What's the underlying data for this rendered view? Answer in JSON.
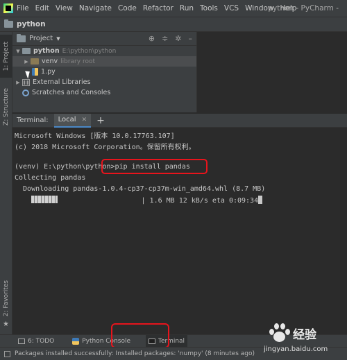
{
  "menubar": {
    "items": [
      "File",
      "Edit",
      "View",
      "Navigate",
      "Code",
      "Refactor",
      "Run",
      "Tools",
      "VCS",
      "Window",
      "Help"
    ],
    "window_title": "python - PyCharm -"
  },
  "breadcrumb": {
    "label": "python"
  },
  "left_stripe": {
    "project_tab": "1: Project",
    "structure_tab": "Z: Structure",
    "favorites_tab": "2: Favorites"
  },
  "project_panel": {
    "view_label": "Project",
    "tree": {
      "root_name": "python",
      "root_path": "E:\\python\\python",
      "venv_name": "venv",
      "venv_hint": "library root",
      "file_name": "1.py",
      "external_libraries": "External Libraries",
      "scratches": "Scratches and Consoles"
    }
  },
  "terminal": {
    "label": "Terminal:",
    "tab_label": "Local",
    "add_symbol": "+",
    "lines": {
      "os_line": "Microsoft Windows [版本 10.0.17763.107]",
      "copyright_line": "(c) 2018 Microsoft Corporation。保留所有权利。",
      "prompt": "(venv) E:\\python\\python>",
      "command": "pip install pandas",
      "collecting": "Collecting pandas",
      "downloading": "  Downloading pandas-1.0.4-cp37-cp37m-win_amd64.whl (8.7 MB)",
      "progress_status": "| 1.6 MB 12 kB/s eta 0:09:34"
    },
    "download_progress": 0.18
  },
  "bottom_tabs": {
    "todo": "6: TODO",
    "python_console": "Python Console",
    "terminal": "Terminal"
  },
  "status_bar": {
    "message": "Packages installed successfully: Installed packages: 'numpy' (8 minutes ago)"
  },
  "watermark": {
    "brand": "经验",
    "url": "jingyan.baidu.com"
  },
  "colors": {
    "highlight_box": "#e8141c",
    "ui_background": "#3c3f41",
    "terminal_background": "#2b2b2b"
  }
}
